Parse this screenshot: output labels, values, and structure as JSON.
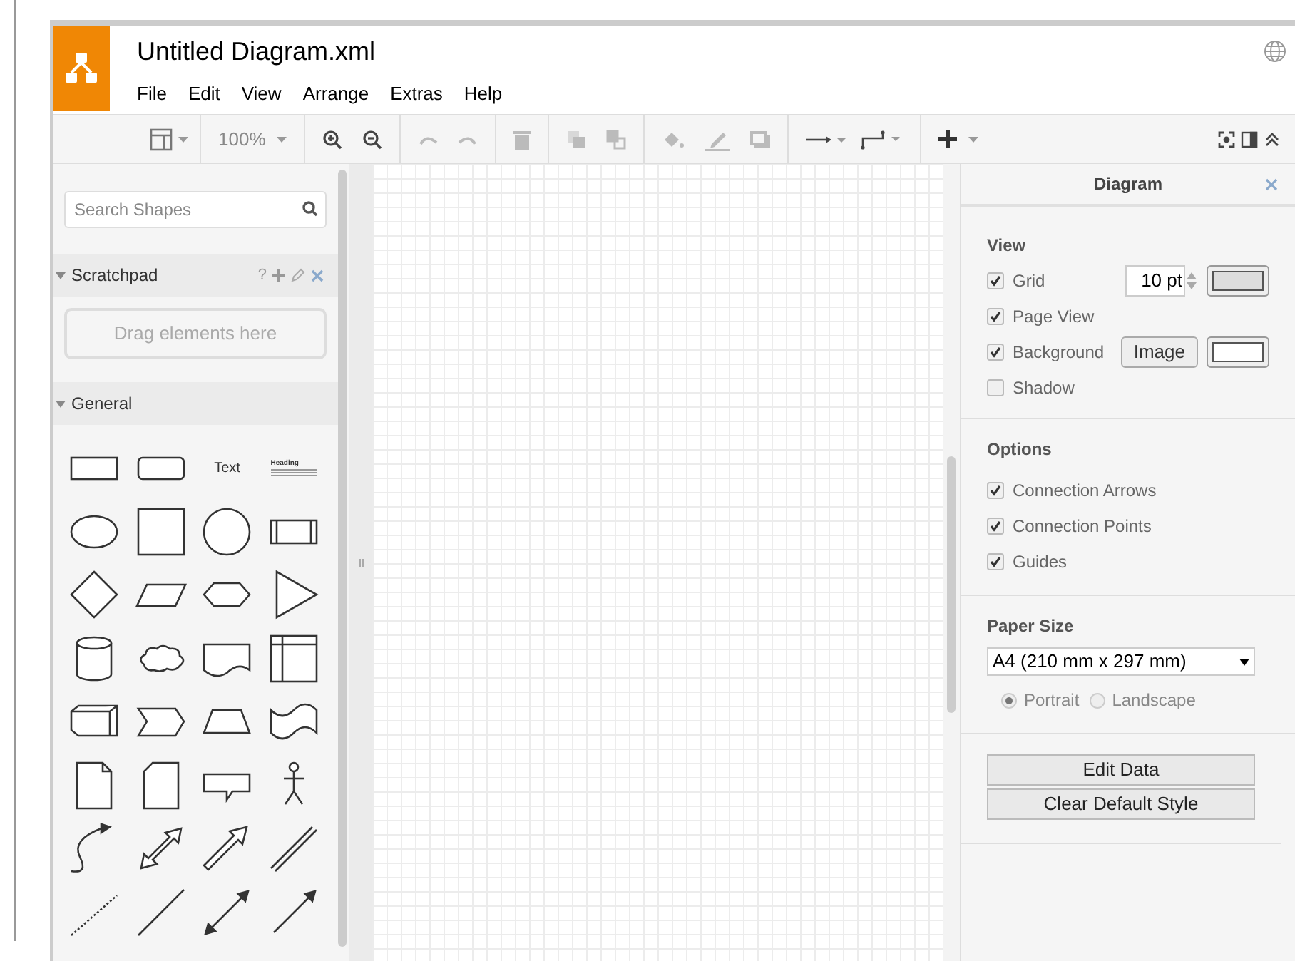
{
  "window": {
    "title": "Untitled Diagram.xml"
  },
  "menu": [
    "File",
    "Edit",
    "View",
    "Arrange",
    "Extras",
    "Help"
  ],
  "toolbar": {
    "zoom": "100%"
  },
  "sidebar": {
    "search": {
      "placeholder": "Search Shapes"
    },
    "scratchpad": {
      "title": "Scratchpad",
      "expanded": true,
      "help": "?",
      "drop_hint": "Drag elements here"
    },
    "general": {
      "title": "General",
      "expanded": true
    },
    "shapes": [
      {
        "kind": "rect"
      },
      {
        "kind": "rounded"
      },
      {
        "kind": "text",
        "label": "Text"
      },
      {
        "kind": "heading",
        "label": "Heading"
      },
      {
        "kind": "ellipse"
      },
      {
        "kind": "square"
      },
      {
        "kind": "circle"
      },
      {
        "kind": "process"
      },
      {
        "kind": "diamond"
      },
      {
        "kind": "parallelogram"
      },
      {
        "kind": "hexagon"
      },
      {
        "kind": "triangle"
      },
      {
        "kind": "cylinder"
      },
      {
        "kind": "cloud"
      },
      {
        "kind": "document"
      },
      {
        "kind": "storage"
      },
      {
        "kind": "cube"
      },
      {
        "kind": "step"
      },
      {
        "kind": "trapezoid"
      },
      {
        "kind": "tape"
      },
      {
        "kind": "note"
      },
      {
        "kind": "card"
      },
      {
        "kind": "callout"
      },
      {
        "kind": "actor"
      },
      {
        "kind": "curve"
      },
      {
        "kind": "double-arrow"
      },
      {
        "kind": "arrow"
      },
      {
        "kind": "link"
      },
      {
        "kind": "dashed"
      },
      {
        "kind": "line"
      },
      {
        "kind": "double-connector"
      },
      {
        "kind": "connector"
      }
    ]
  },
  "panel": {
    "title": "Diagram",
    "view": {
      "title": "View",
      "options": [
        {
          "kind": "grid",
          "label": "Grid",
          "checked": true,
          "value": "10 pt"
        },
        {
          "kind": "plain",
          "label": "Page View",
          "checked": true
        },
        {
          "kind": "background",
          "label": "Background",
          "checked": true,
          "button": "Image"
        },
        {
          "kind": "plain",
          "label": "Shadow",
          "checked": false
        }
      ]
    },
    "options": {
      "title": "Options",
      "items": [
        {
          "label": "Connection Arrows",
          "checked": true
        },
        {
          "label": "Connection Points",
          "checked": true
        },
        {
          "label": "Guides",
          "checked": true
        }
      ]
    },
    "paper": {
      "title": "Paper Size",
      "value": "A4 (210 mm x 297 mm)",
      "orientations": [
        {
          "label": "Portrait",
          "selected": true
        },
        {
          "label": "Landscape",
          "selected": false
        }
      ]
    },
    "buttons": [
      "Edit Data",
      "Clear Default Style"
    ]
  }
}
